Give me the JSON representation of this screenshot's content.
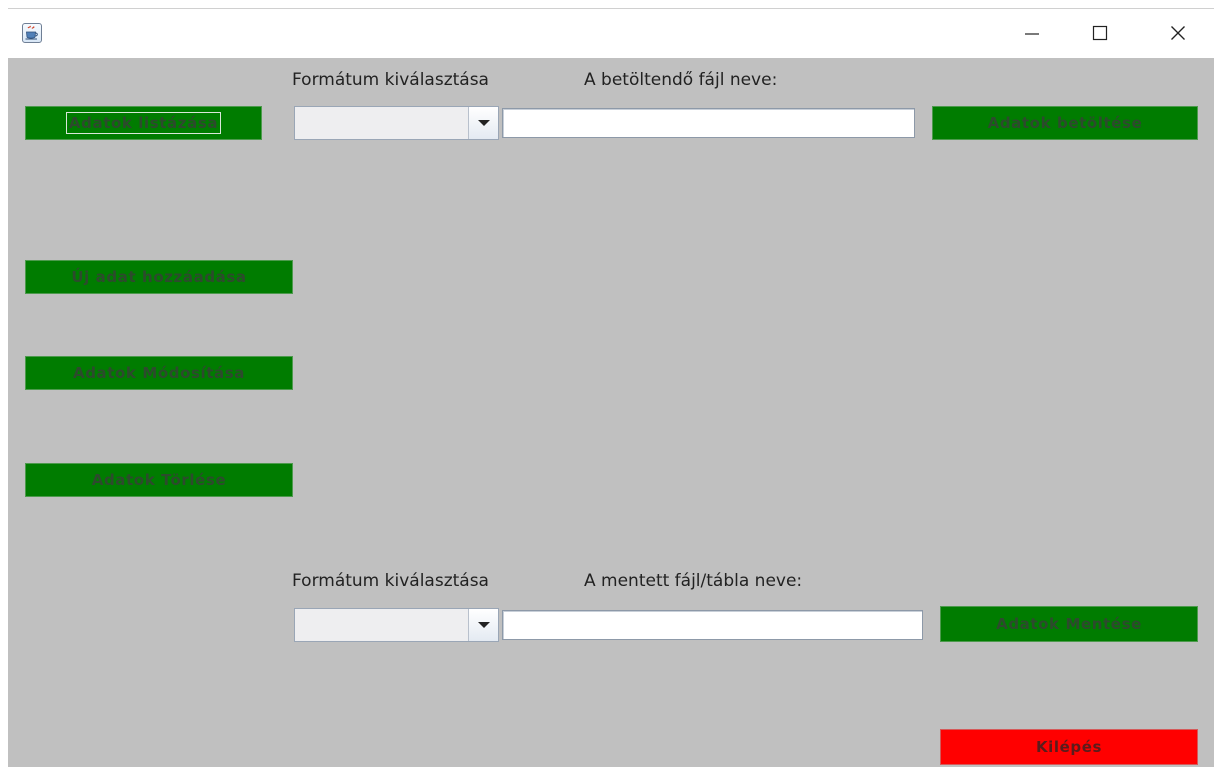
{
  "window": {
    "title": ""
  },
  "titlebar": {
    "app_icon": "java-coffee-cup-icon",
    "controls": [
      {
        "name": "minimize-icon",
        "glyph": "—"
      },
      {
        "name": "maximize-icon",
        "glyph": "☐"
      },
      {
        "name": "close-icon",
        "glyph": "✕"
      }
    ]
  },
  "buttons": {
    "list": "Adatok listázása",
    "load": "Adatok betöltése",
    "add": "Új adat hozzáadása",
    "modify": "Adatok Módosítása",
    "delete": "Adatok Törlése",
    "save": "Adatok Mentése",
    "exit": "Kilépés"
  },
  "load_section": {
    "format_label": "Formátum kiválasztása",
    "format_value": "",
    "filename_label": "A betöltendő fájl neve:",
    "filename_value": ""
  },
  "save_section": {
    "format_label": "Formátum kiválasztása",
    "format_value": "",
    "filename_label": "A mentett fájl/tábla neve:",
    "filename_value": ""
  },
  "colors": {
    "window_background": "#c0c0c0",
    "action_button": "#007c00",
    "exit_button": "#ff0000",
    "button_text": "#2d4a2d"
  }
}
